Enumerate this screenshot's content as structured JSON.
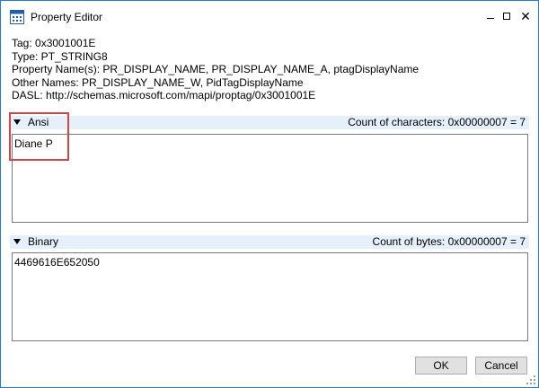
{
  "window": {
    "title": "Property Editor",
    "icon": "property-editor-app-icon"
  },
  "info": {
    "tag": "Tag: 0x3001001E",
    "type": "Type: PT_STRING8",
    "property_names": "Property Name(s): PR_DISPLAY_NAME, PR_DISPLAY_NAME_A, ptagDisplayName",
    "other_names": "Other Names: PR_DISPLAY_NAME_W, PidTagDisplayName",
    "dasl": "DASL: http://schemas.microsoft.com/mapi/proptag/0x3001001E"
  },
  "ansi": {
    "label": "Ansi",
    "count": "Count of characters: 0x00000007 = 7",
    "value": "Diane P"
  },
  "binary": {
    "label": "Binary",
    "count": "Count of bytes: 0x00000007 = 7",
    "value": "4469616E652050"
  },
  "buttons": {
    "ok": "OK",
    "cancel": "Cancel"
  },
  "colors": {
    "window_border": "#1e7fd6",
    "section_header": "#e5f0fb",
    "highlight": "#d64545"
  }
}
